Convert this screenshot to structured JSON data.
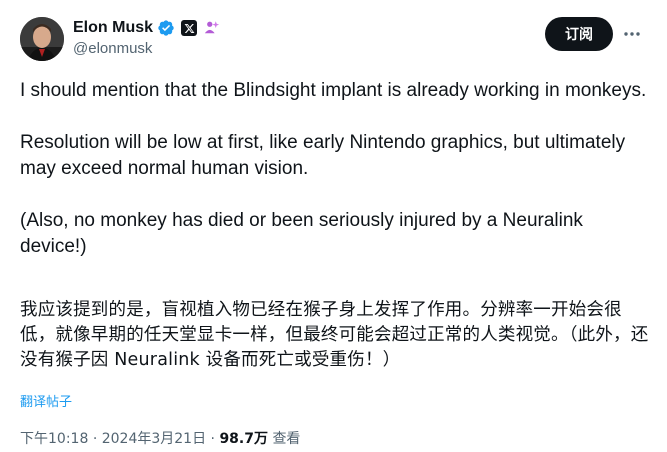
{
  "author": {
    "name": "Elon Musk",
    "handle": "@elonmusk"
  },
  "icons": {
    "verified": "verified-badge-icon",
    "affiliate": "x-logo-icon",
    "org": "affiliation-icon",
    "more": "more-icon"
  },
  "colors": {
    "verified_blue": "#1d9bf0",
    "subscribe_bg": "#0f1419",
    "secondary_text": "#536471"
  },
  "subscribe_label": "订阅",
  "tweet": {
    "para1": "I should mention that the Blindsight implant is already working in monkeys.",
    "para2": "Resolution will be low at first, like early Nintendo graphics, but ultimately may exceed normal human vision.",
    "para3": "(Also, no monkey has died or been seriously injured by a Neuralink device!)",
    "translation": "我应该提到的是，盲视植入物已经在猴子身上发挥了作用。分辨率一开始会很低，就像早期的任天堂显卡一样，但最终可能会超过正常的人类视觉。（此外，还没有猴子因 Neuralink 设备而死亡或受重伤！）"
  },
  "translate_label": "翻译帖子",
  "meta": {
    "time": "下午10:18",
    "sep": "·",
    "date": "2024年3月21日",
    "views": "98.7万",
    "views_label": "查看"
  }
}
